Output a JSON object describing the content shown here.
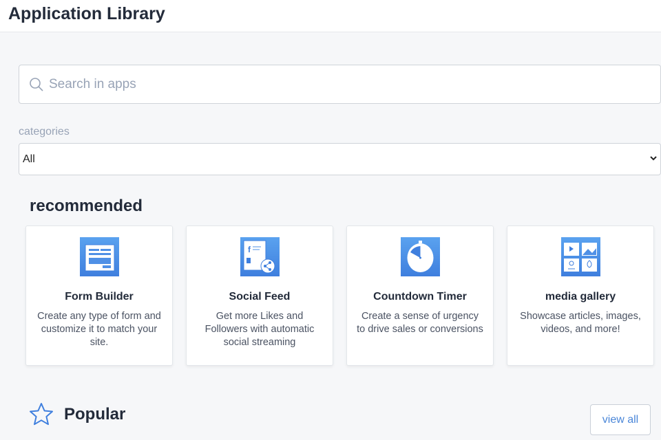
{
  "header": {
    "title": "Application Library"
  },
  "search": {
    "placeholder": "Search in apps"
  },
  "categories": {
    "label": "categories",
    "selected": "All"
  },
  "recommended": {
    "title": "recommended",
    "apps": [
      {
        "name": "Form Builder",
        "description": "Create any type of form and customize it to match your site.",
        "icon": "form-icon"
      },
      {
        "name": "Social Feed",
        "description": "Get more Likes and Followers with automatic social streaming",
        "icon": "social-feed-icon"
      },
      {
        "name": "Countdown Timer",
        "description": "Create a sense of urgency to drive sales or conversions",
        "icon": "stopwatch-icon"
      },
      {
        "name": "media gallery",
        "description": "Showcase articles, images, videos, and more!",
        "icon": "gallery-icon"
      }
    ]
  },
  "popular": {
    "title": "Popular",
    "view_all": "view all"
  },
  "colors": {
    "accent": "#4a86d8",
    "icon_bg": "#4f90e6"
  }
}
